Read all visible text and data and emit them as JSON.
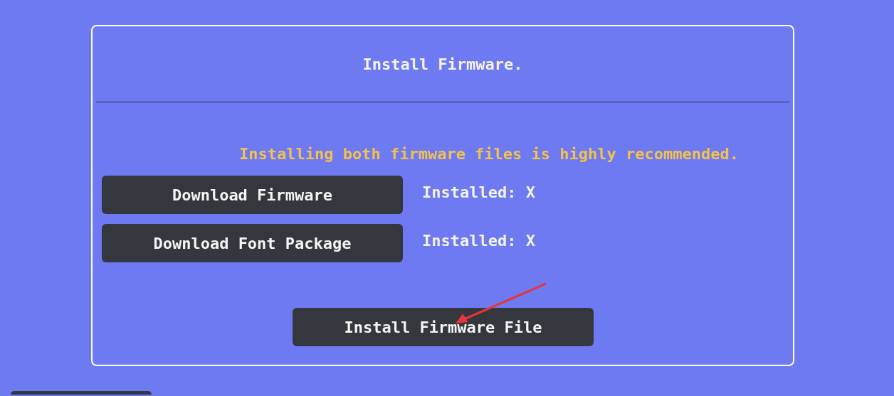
{
  "title": "Install Firmware.",
  "notice": "Installing both firmware files is highly recommended.",
  "downloads": [
    {
      "label": "Download Firmware",
      "status": "Installed: X"
    },
    {
      "label": "Download Font Package",
      "status": "Installed: X"
    }
  ],
  "install_button": "Install Firmware File"
}
